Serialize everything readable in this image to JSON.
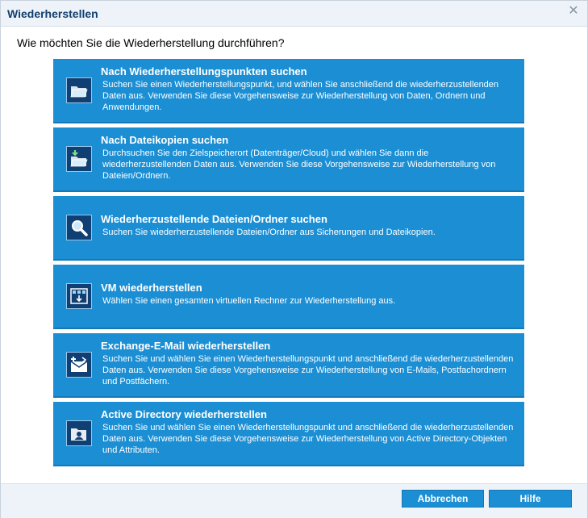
{
  "dialog": {
    "title": "Wiederherstellen",
    "close": "✕"
  },
  "question": "Wie möchten Sie die Wiederherstellung durchführen?",
  "options": [
    {
      "title": "Nach Wiederherstellungspunkten suchen",
      "description": "Suchen Sie einen Wiederherstellungspunkt, und wählen Sie anschließend die wiederherzustellenden Daten aus. Verwenden Sie diese Vorgehensweise zur Wiederherstellung von Daten, Ordnern und Anwendungen.",
      "icon": "folder-open-icon"
    },
    {
      "title": "Nach Dateikopien suchen",
      "description": "Durchsuchen Sie den Zielspeicherort (Datenträger/Cloud) und wählen Sie dann die wiederherzustellenden Daten aus. Verwenden Sie diese Vorgehensweise zur Wiederherstellung von Dateien/Ordnern.",
      "icon": "folder-download-icon"
    },
    {
      "title": "Wiederherzustellende Dateien/Ordner suchen",
      "description": "Suchen Sie wiederherzustellende Dateien/Ordner aus Sicherungen und Dateikopien.",
      "icon": "search-icon"
    },
    {
      "title": "VM wiederherstellen",
      "description": "Wählen Sie einen gesamten virtuellen Rechner zur Wiederherstellung aus.",
      "icon": "virtual-machine-icon"
    },
    {
      "title": "Exchange-E-Mail wiederherstellen",
      "description": "Suchen Sie und wählen Sie einen Wiederherstellungspunkt und anschließend die wiederherzustellenden Daten aus. Verwenden Sie diese Vorgehensweise zur Wiederherstellung von E-Mails, Postfachordnern und Postfächern.",
      "icon": "exchange-mail-icon"
    },
    {
      "title": "Active Directory wiederherstellen",
      "description": "Suchen Sie und wählen Sie einen Wiederherstellungspunkt und anschließend die wiederherzustellenden Daten aus. Verwenden Sie diese Vorgehensweise zur Wiederherstellung von Active Directory-Objekten und Attributen.",
      "icon": "active-directory-icon"
    }
  ],
  "buttons": {
    "cancel": "Abbrechen",
    "help": "Hilfe"
  },
  "colors": {
    "accent": "#1c8fd4",
    "title_text": "#123f6e",
    "icon_bg": "#0f3f73"
  }
}
